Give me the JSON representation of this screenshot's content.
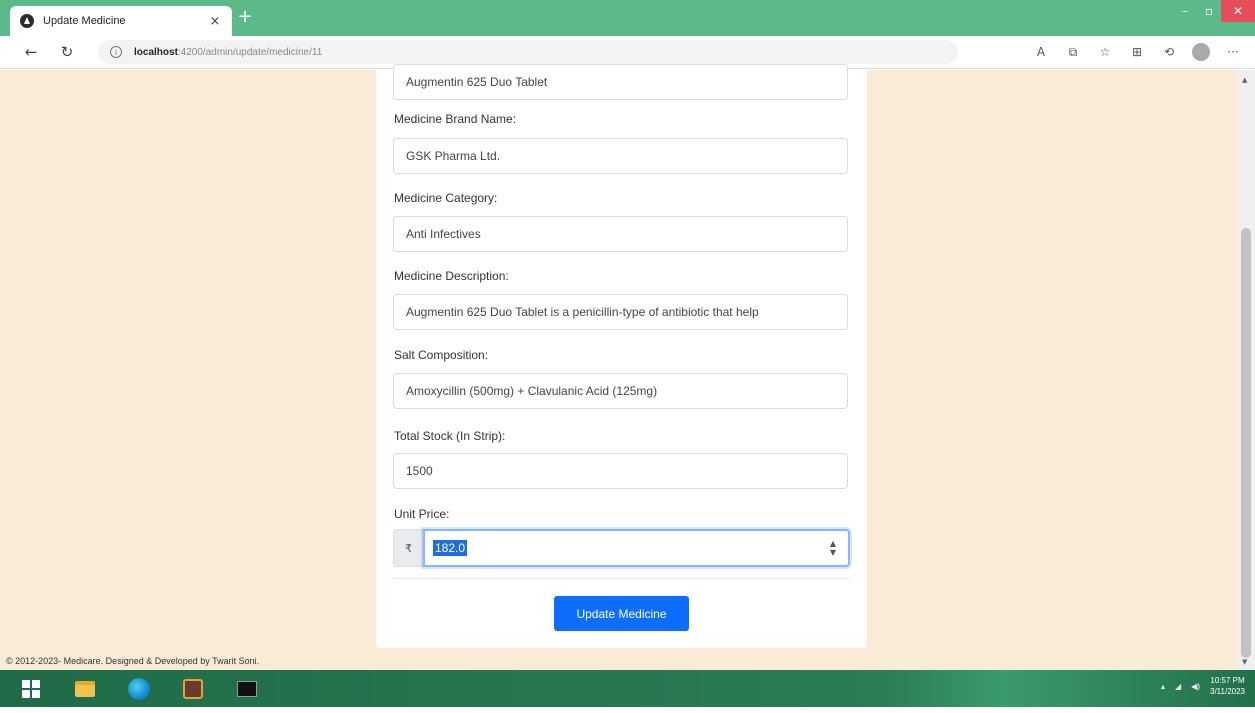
{
  "browser": {
    "tab_title": "Update Medicine",
    "tab_close": "×",
    "new_tab": "+",
    "url_host": "localhost",
    "url_path": ":4200/admin/update/medicine/11",
    "window_controls": {
      "minimize": "–",
      "maximize": "▫",
      "close": "✕"
    }
  },
  "form": {
    "medicine_name_value": "Augmentin 625 Duo Tablet",
    "brand_label": "Medicine Brand Name:",
    "brand_value": "GSK Pharma Ltd.",
    "category_label": "Medicine Category:",
    "category_value": "Anti Infectives",
    "description_label": "Medicine Description:",
    "description_value": "Augmentin 625 Duo Tablet is a penicillin-type of antibiotic that help",
    "salt_label": "Salt Composition:",
    "salt_value": "Amoxycillin (500mg) + Clavulanic Acid (125mg)",
    "stock_label": "Total Stock (In Strip):",
    "stock_value": "1500",
    "price_label": "Unit Price:",
    "currency_symbol": "₹",
    "price_value": "182.0",
    "submit_label": "Update Medicine"
  },
  "footer": {
    "text": "© 2012-2023- Medicare. Designed & Developed by Twarit Soni."
  },
  "taskbar": {
    "time": "10:57 PM",
    "date": "3/11/2023"
  },
  "colors": {
    "browser_frame": "#5cb98a",
    "page_background": "#faebd7",
    "primary_button": "#0d6efd"
  }
}
